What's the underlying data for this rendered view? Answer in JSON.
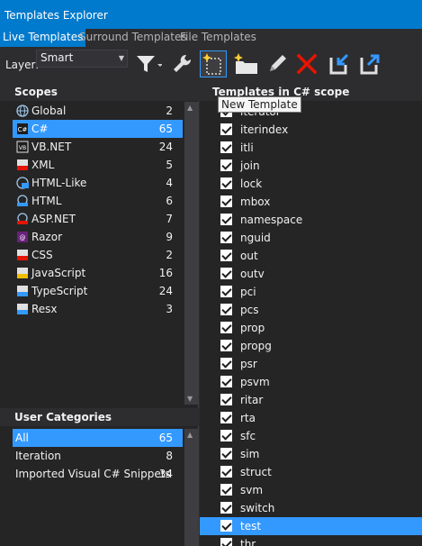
{
  "window": {
    "title": "Templates Explorer"
  },
  "tabs": [
    {
      "label": "Live Templates",
      "active": true
    },
    {
      "label": "Surround Templates",
      "active": false
    },
    {
      "label": "File Templates",
      "active": false
    }
  ],
  "toolbar": {
    "layer_label": "Layer:",
    "layer_value": "Smart",
    "buttons": [
      "filter-icon",
      "wrench-icon",
      "new-template-icon",
      "new-folder-icon",
      "edit-pencil-icon",
      "delete-x-icon",
      "import-icon",
      "export-icon"
    ],
    "tooltip": "New Template"
  },
  "scopes": {
    "header": "Scopes",
    "items": [
      {
        "label": "Global",
        "count": "2",
        "icon": "globe-icon",
        "selected": false
      },
      {
        "label": "C#",
        "count": "65",
        "icon": "csharp-icon",
        "selected": true
      },
      {
        "label": "VB.NET",
        "count": "24",
        "icon": "vbnet-icon",
        "selected": false
      },
      {
        "label": "XML",
        "count": "5",
        "icon": "xml-icon",
        "selected": false
      },
      {
        "label": "HTML-Like",
        "count": "4",
        "icon": "html-like-icon",
        "selected": false
      },
      {
        "label": "HTML",
        "count": "6",
        "icon": "html-icon",
        "selected": false
      },
      {
        "label": "ASP.NET",
        "count": "7",
        "icon": "aspnet-icon",
        "selected": false
      },
      {
        "label": "Razor",
        "count": "9",
        "icon": "razor-icon",
        "selected": false
      },
      {
        "label": "CSS",
        "count": "2",
        "icon": "css-icon",
        "selected": false
      },
      {
        "label": "JavaScript",
        "count": "16",
        "icon": "javascript-icon",
        "selected": false
      },
      {
        "label": "TypeScript",
        "count": "24",
        "icon": "typescript-icon",
        "selected": false
      },
      {
        "label": "Resx",
        "count": "3",
        "icon": "resx-icon",
        "selected": false
      }
    ]
  },
  "categories": {
    "header": "User Categories",
    "items": [
      {
        "label": "All",
        "count": "65",
        "selected": true
      },
      {
        "label": "Iteration",
        "count": "8",
        "selected": false
      },
      {
        "label": "Imported Visual C# Snippets",
        "count": "34",
        "selected": false
      }
    ]
  },
  "templates": {
    "header": "Templates in C# scope",
    "items": [
      {
        "label": "iterator",
        "checked": true,
        "selected": false
      },
      {
        "label": "iterindex",
        "checked": true,
        "selected": false
      },
      {
        "label": "itli",
        "checked": true,
        "selected": false
      },
      {
        "label": "join",
        "checked": true,
        "selected": false
      },
      {
        "label": "lock",
        "checked": true,
        "selected": false
      },
      {
        "label": "mbox",
        "checked": true,
        "selected": false
      },
      {
        "label": "namespace",
        "checked": true,
        "selected": false
      },
      {
        "label": "nguid",
        "checked": true,
        "selected": false
      },
      {
        "label": "out",
        "checked": true,
        "selected": false
      },
      {
        "label": "outv",
        "checked": true,
        "selected": false
      },
      {
        "label": "pci",
        "checked": true,
        "selected": false
      },
      {
        "label": "pcs",
        "checked": true,
        "selected": false
      },
      {
        "label": "prop",
        "checked": true,
        "selected": false
      },
      {
        "label": "propg",
        "checked": true,
        "selected": false
      },
      {
        "label": "psr",
        "checked": true,
        "selected": false
      },
      {
        "label": "psvm",
        "checked": true,
        "selected": false
      },
      {
        "label": "ritar",
        "checked": true,
        "selected": false
      },
      {
        "label": "rta",
        "checked": true,
        "selected": false
      },
      {
        "label": "sfc",
        "checked": true,
        "selected": false
      },
      {
        "label": "sim",
        "checked": true,
        "selected": false
      },
      {
        "label": "struct",
        "checked": true,
        "selected": false
      },
      {
        "label": "svm",
        "checked": true,
        "selected": false
      },
      {
        "label": "switch",
        "checked": true,
        "selected": false
      },
      {
        "label": "test",
        "checked": true,
        "selected": true
      },
      {
        "label": "thr",
        "checked": true,
        "selected": false
      }
    ]
  },
  "colors": {
    "accent": "#007acc",
    "selection": "#3399ff",
    "background": "#252526",
    "toolbar_bg": "#2d2d30",
    "delete_red": "#e51400",
    "import_blue": "#3399ff",
    "folder_yellow": "#dcb67a"
  }
}
